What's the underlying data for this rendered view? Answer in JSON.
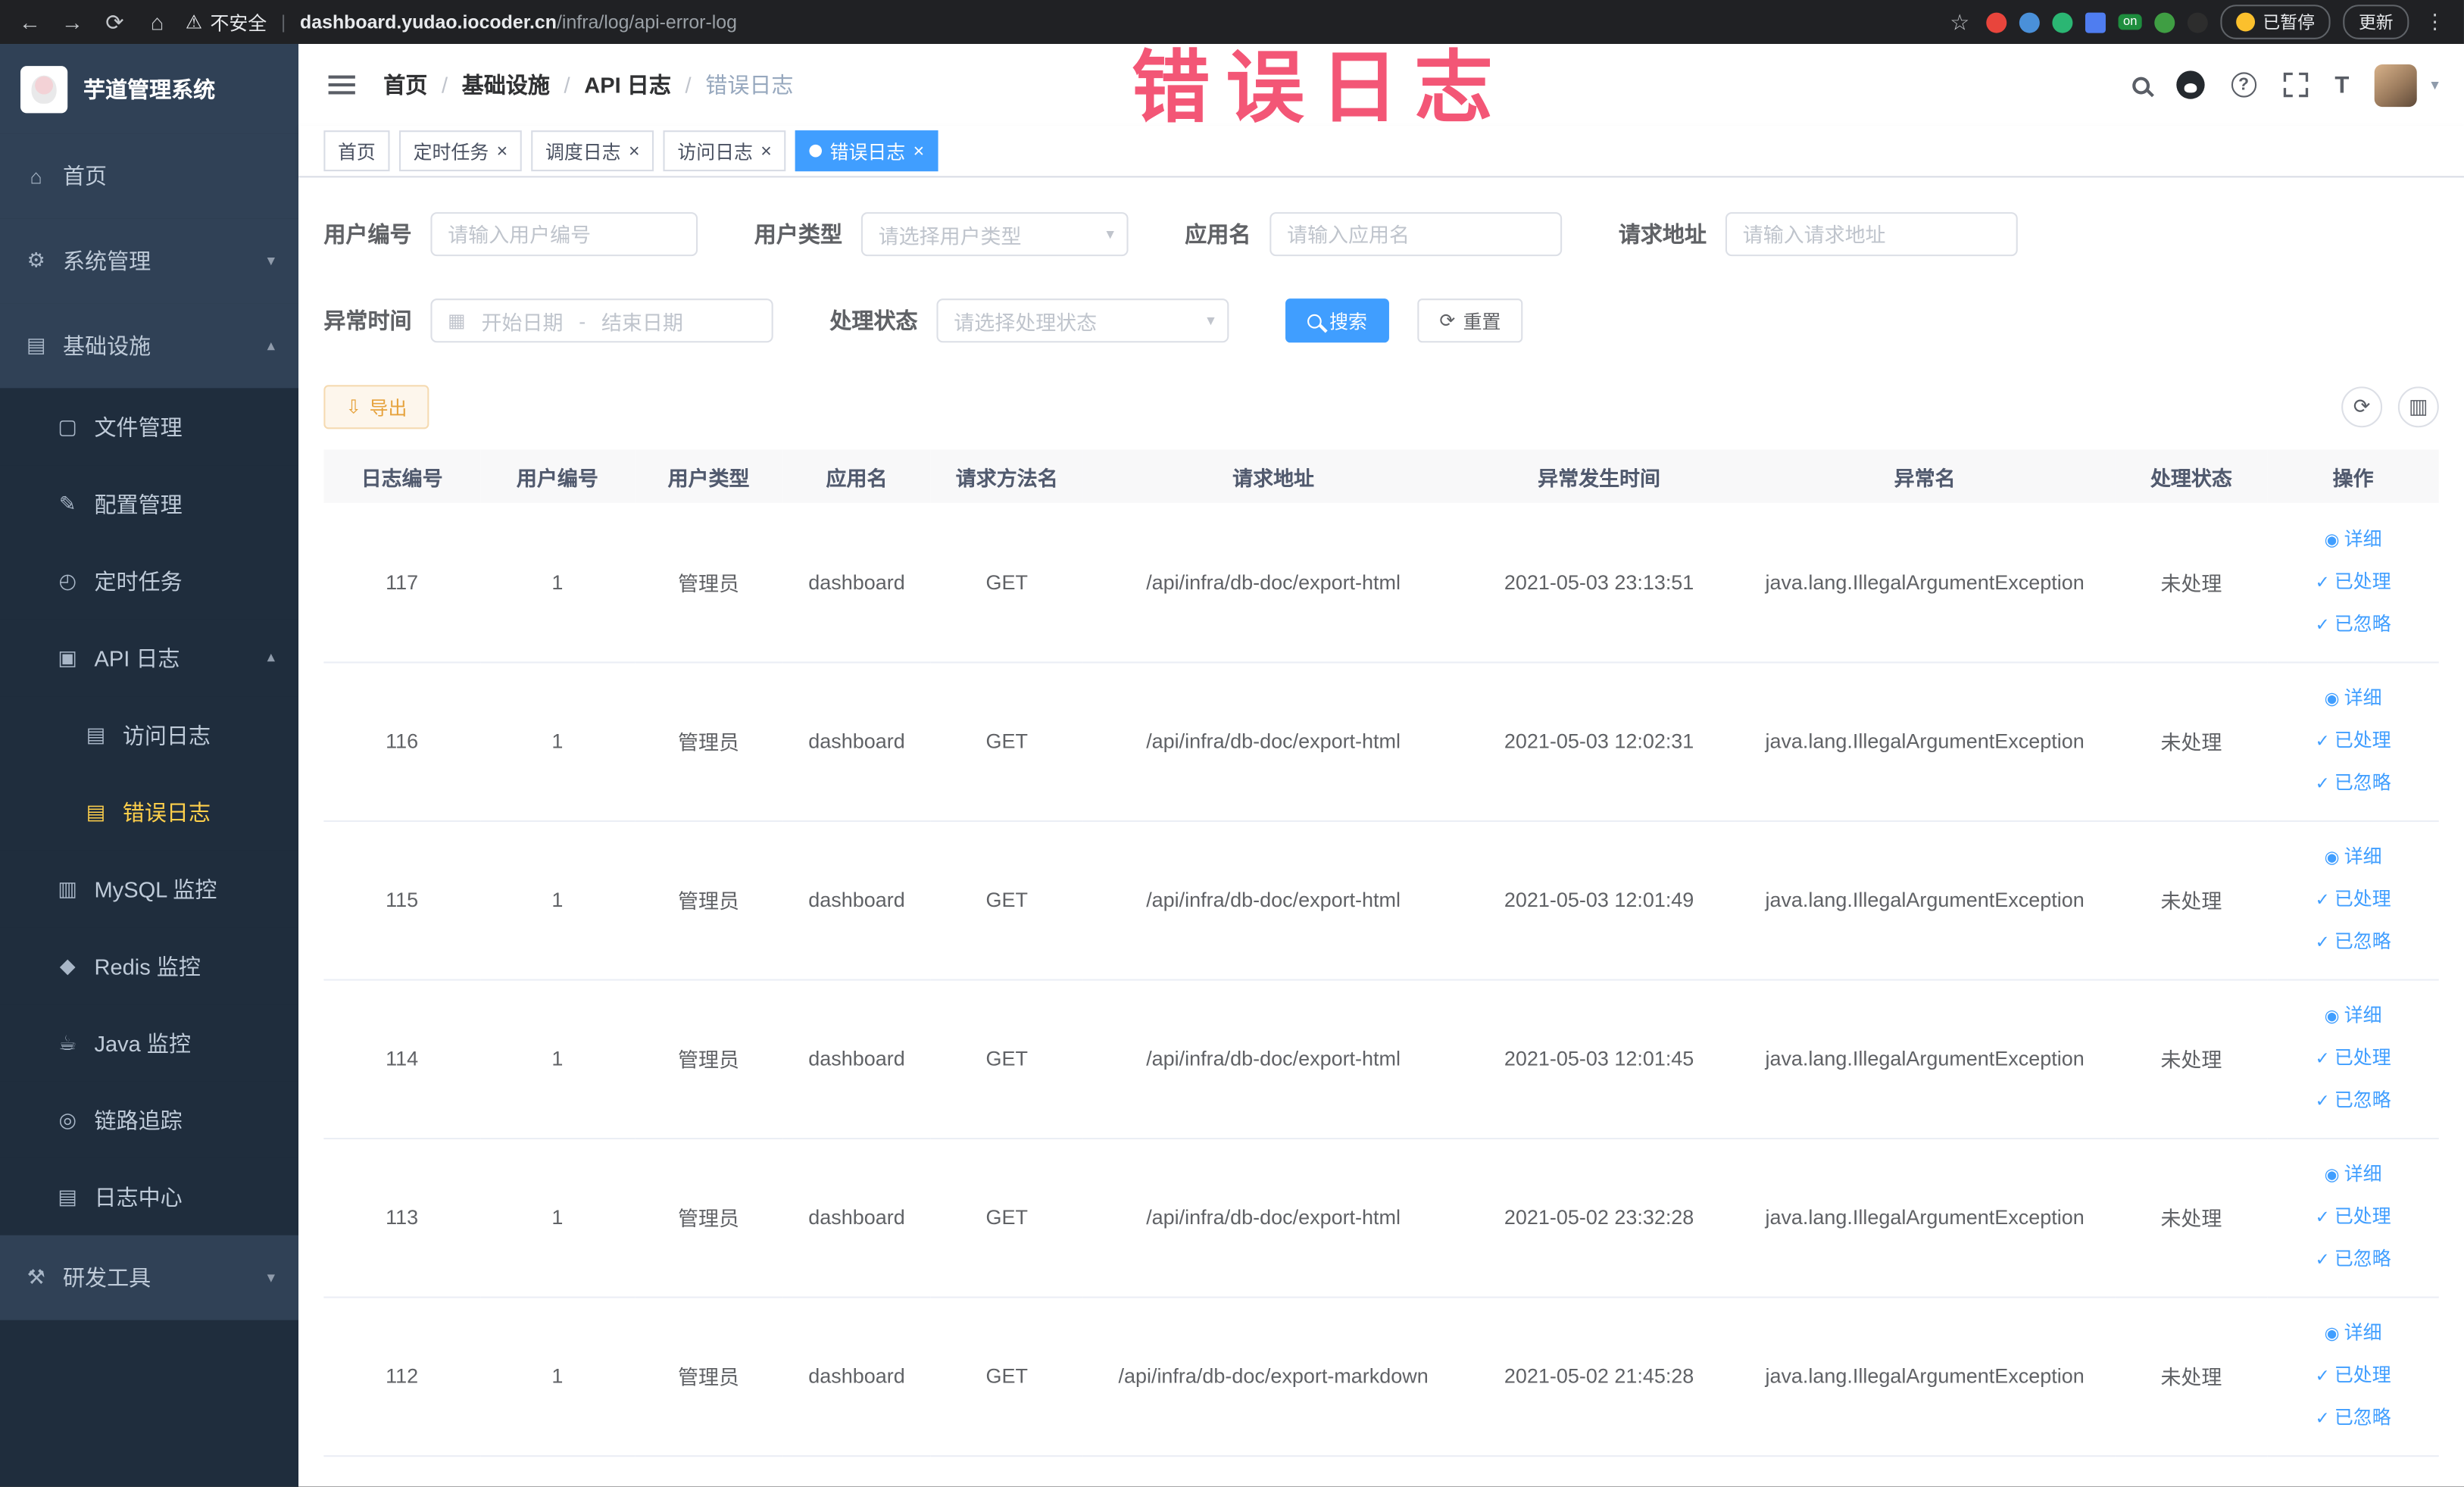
{
  "browser": {
    "security_warning": "不安全",
    "url_domain": "dashboard.yudao.iocoder.cn",
    "url_path": "/infra/log/api-error-log",
    "ext_on_badge": "on",
    "paused_badge": "已暂停",
    "update_button": "更新"
  },
  "watermark": "错误日志",
  "sidebar": {
    "app_title": "芋道管理系统",
    "items": [
      {
        "label": "首页"
      },
      {
        "label": "系统管理"
      },
      {
        "label": "基础设施"
      },
      {
        "label": "文件管理"
      },
      {
        "label": "配置管理"
      },
      {
        "label": "定时任务"
      },
      {
        "label": "API 日志"
      },
      {
        "label": "访问日志"
      },
      {
        "label": "错误日志"
      },
      {
        "label": "MySQL 监控"
      },
      {
        "label": "Redis 监控"
      },
      {
        "label": "Java 监控"
      },
      {
        "label": "链路追踪"
      },
      {
        "label": "日志中心"
      },
      {
        "label": "研发工具"
      }
    ]
  },
  "breadcrumb": {
    "separator": "/",
    "items": [
      "首页",
      "基础设施",
      "API 日志",
      "错误日志"
    ]
  },
  "tabs": [
    {
      "label": "首页"
    },
    {
      "label": "定时任务"
    },
    {
      "label": "调度日志"
    },
    {
      "label": "访问日志"
    },
    {
      "label": "错误日志"
    }
  ],
  "filters": {
    "user_id_label": "用户编号",
    "user_id_placeholder": "请输入用户编号",
    "user_type_label": "用户类型",
    "user_type_placeholder": "请选择用户类型",
    "app_name_label": "应用名",
    "app_name_placeholder": "请输入应用名",
    "request_url_label": "请求地址",
    "request_url_placeholder": "请输入请求地址",
    "time_label": "异常时间",
    "time_start_placeholder": "开始日期",
    "time_separator": "-",
    "time_end_placeholder": "结束日期",
    "status_label": "处理状态",
    "status_placeholder": "请选择处理状态",
    "search_button": "搜索",
    "reset_button": "重置"
  },
  "toolbar": {
    "export_button": "导出"
  },
  "table": {
    "columns": [
      "日志编号",
      "用户编号",
      "用户类型",
      "应用名",
      "请求方法名",
      "请求地址",
      "异常发生时间",
      "异常名",
      "处理状态",
      "操作"
    ],
    "actions": [
      "详细",
      "已处理",
      "已忽略"
    ],
    "rows": [
      {
        "log_id": "117",
        "user_id": "1",
        "user_type": "管理员",
        "app_name": "dashboard",
        "method": "GET",
        "url": "/api/infra/db-doc/export-html",
        "time": "2021-05-03 23:13:51",
        "exception": "java.lang.IllegalArgumentException",
        "status": "未处理"
      },
      {
        "log_id": "116",
        "user_id": "1",
        "user_type": "管理员",
        "app_name": "dashboard",
        "method": "GET",
        "url": "/api/infra/db-doc/export-html",
        "time": "2021-05-03 12:02:31",
        "exception": "java.lang.IllegalArgumentException",
        "status": "未处理"
      },
      {
        "log_id": "115",
        "user_id": "1",
        "user_type": "管理员",
        "app_name": "dashboard",
        "method": "GET",
        "url": "/api/infra/db-doc/export-html",
        "time": "2021-05-03 12:01:49",
        "exception": "java.lang.IllegalArgumentException",
        "status": "未处理"
      },
      {
        "log_id": "114",
        "user_id": "1",
        "user_type": "管理员",
        "app_name": "dashboard",
        "method": "GET",
        "url": "/api/infra/db-doc/export-html",
        "time": "2021-05-03 12:01:45",
        "exception": "java.lang.IllegalArgumentException",
        "status": "未处理"
      },
      {
        "log_id": "113",
        "user_id": "1",
        "user_type": "管理员",
        "app_name": "dashboard",
        "method": "GET",
        "url": "/api/infra/db-doc/export-html",
        "time": "2021-05-02 23:32:28",
        "exception": "java.lang.IllegalArgumentException",
        "status": "未处理"
      },
      {
        "log_id": "112",
        "user_id": "1",
        "user_type": "管理员",
        "app_name": "dashboard",
        "method": "GET",
        "url": "/api/infra/db-doc/export-markdown",
        "time": "2021-05-02 21:45:28",
        "exception": "java.lang.IllegalArgumentException",
        "status": "未处理"
      }
    ]
  },
  "colors": {
    "accent": "#409eff",
    "sidebar_bg": "#304156",
    "submenu_bg": "#1f2d3d",
    "active_menu_text": "#ffd04b",
    "warning": "#e6a23c",
    "watermark": "#f34a6c"
  },
  "icons": {
    "back": "←",
    "forward": "→",
    "reload": "⟳",
    "home": "⌂",
    "warning": "⚠",
    "star": "☆",
    "kebab": "⋮",
    "caret-down": "▾",
    "caret-up": "▴",
    "close": "×",
    "check": "✓",
    "eye": "◉",
    "calendar": "▦",
    "download": "⇩",
    "refresh": "⟳",
    "columns": "▥",
    "question": "?",
    "updown": "↕",
    "menu-home": "⌂",
    "menu-system": "⚙",
    "menu-infra": "▤",
    "menu-file": "▢",
    "menu-config": "✎",
    "menu-job": "◴",
    "menu-apilog": "▣",
    "menu-doc": "▤",
    "menu-mysql": "▥",
    "menu-redis": "◆",
    "menu-java": "☕",
    "menu-trace": "◎",
    "menu-logcenter": "▤",
    "menu-tools": "⚒"
  }
}
